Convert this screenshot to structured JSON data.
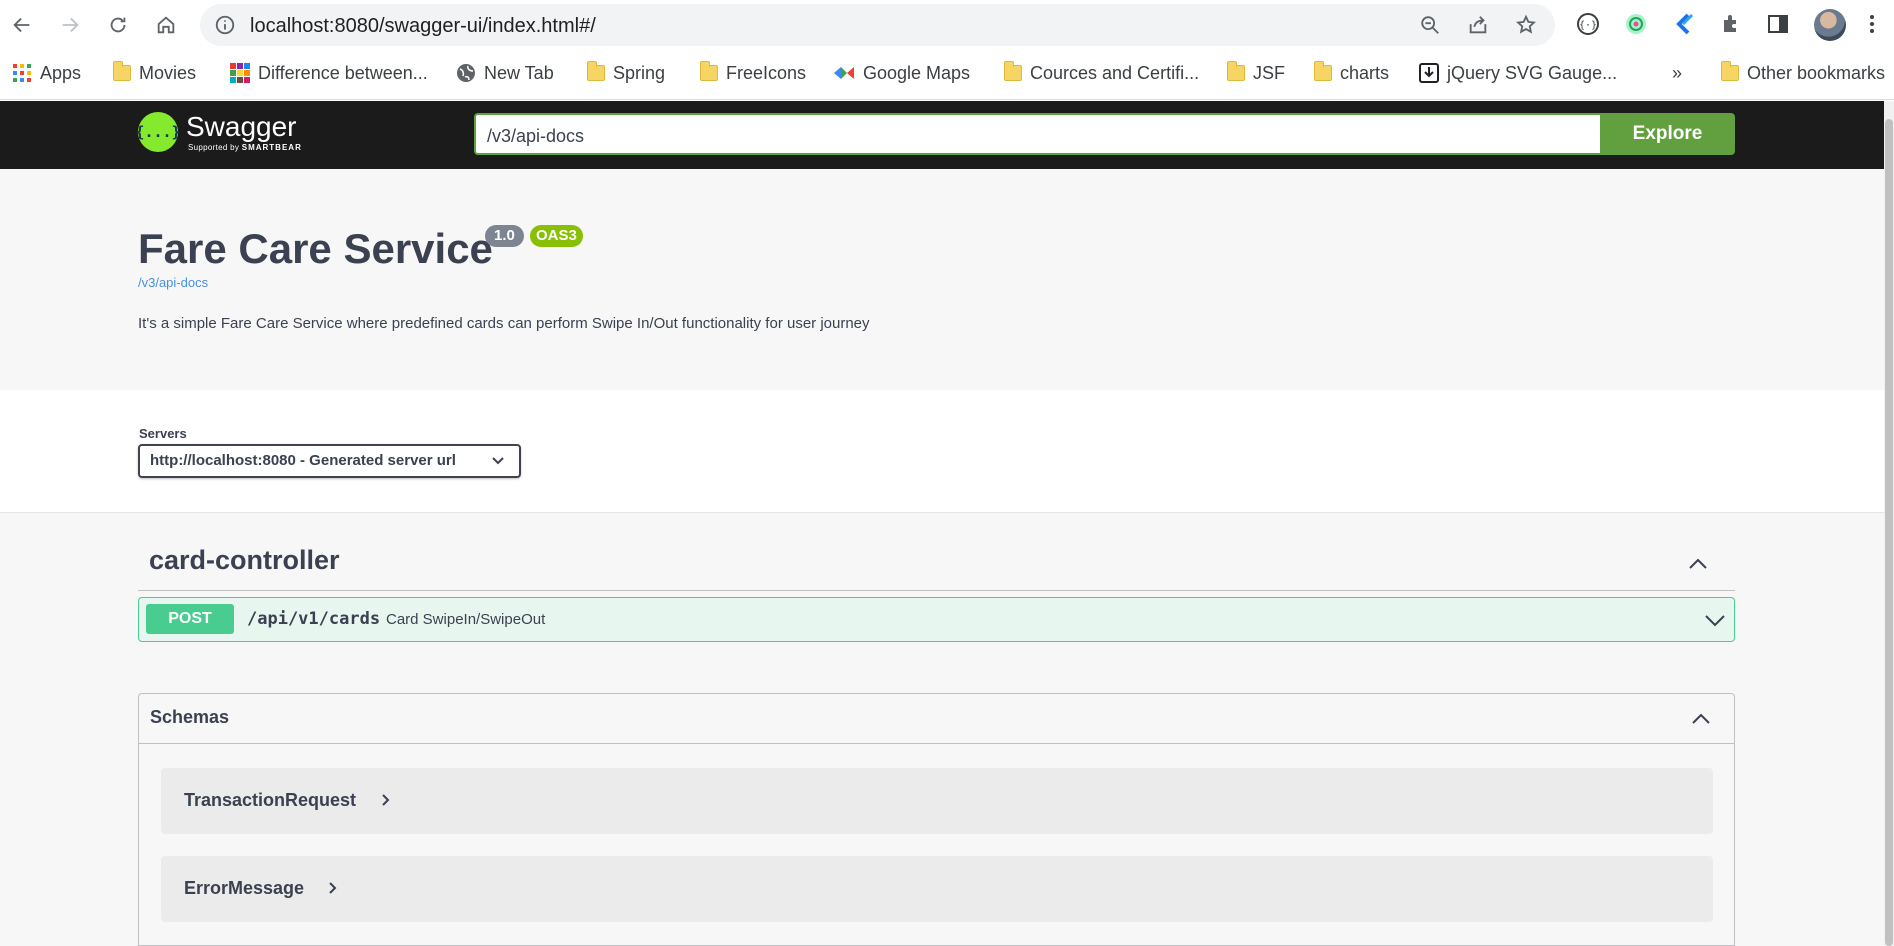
{
  "browser": {
    "url": "localhost:8080/swagger-ui/index.html#/",
    "bookmarks": [
      {
        "label": "Apps",
        "icon": "apps-grid-icon"
      },
      {
        "label": "Movies",
        "icon": "folder-icon"
      },
      {
        "label": "Difference between...",
        "icon": "colorful-grid-icon"
      },
      {
        "label": "New Tab",
        "icon": "globe-icon"
      },
      {
        "label": "Spring",
        "icon": "folder-icon"
      },
      {
        "label": "FreeIcons",
        "icon": "folder-icon"
      },
      {
        "label": "Google Maps",
        "icon": "maps-icon"
      },
      {
        "label": "Cources and Certifi...",
        "icon": "folder-icon"
      },
      {
        "label": "JSF",
        "icon": "folder-icon"
      },
      {
        "label": "charts",
        "icon": "folder-icon"
      },
      {
        "label": "jQuery SVG Gauge...",
        "icon": "download-icon"
      }
    ],
    "overflow_label": "»",
    "other_bookmarks": "Other bookmarks"
  },
  "topbar": {
    "logo_word": "Swagger",
    "logo_sub_prefix": "Supported by",
    "logo_sub_brand": "SMARTBEAR",
    "logo_glyph": "{...}",
    "search_value": "/v3/api-docs",
    "explore_label": "Explore"
  },
  "info": {
    "title": "Fare Care Service",
    "version": "1.0",
    "oas": "OAS3",
    "spec_link": "/v3/api-docs",
    "description": "It's a simple Fare Care Service where predefined cards can perform Swipe In/Out functionality for user journey"
  },
  "servers": {
    "label": "Servers",
    "selected": "http://localhost:8080 - Generated server url"
  },
  "controller": {
    "name": "card-controller",
    "operations": [
      {
        "method": "POST",
        "path": "/api/v1/cards",
        "summary": "Card SwipeIn/SwipeOut"
      }
    ]
  },
  "schemas": {
    "title": "Schemas",
    "models": [
      {
        "name": "TransactionRequest"
      },
      {
        "name": "ErrorMessage"
      }
    ]
  },
  "colors": {
    "post": "#49cc90",
    "explore": "#62a03f",
    "oas_badge": "#89bf04",
    "version_badge": "#7d8492"
  }
}
